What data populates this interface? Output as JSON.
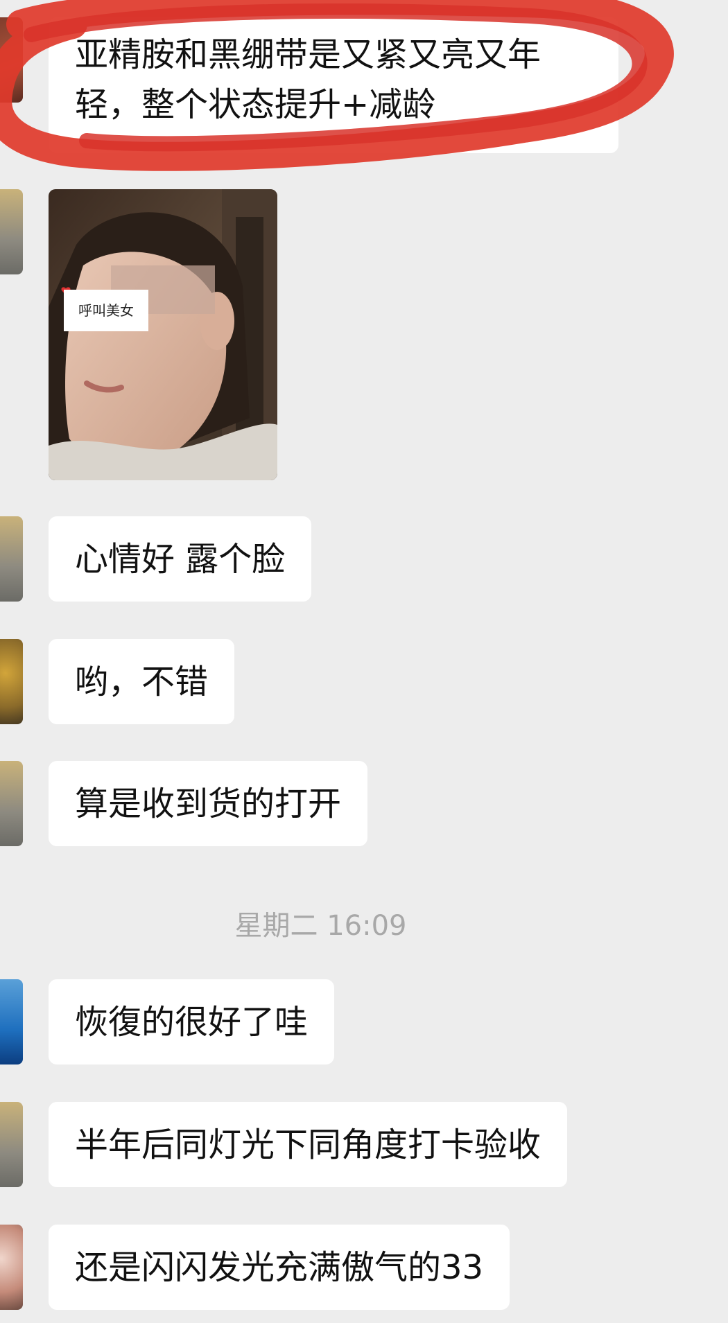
{
  "messages": [
    {
      "id": "m1",
      "text": "亚精胺和黑绷带是又紧又亮又年轻，整个状态提升+减龄"
    },
    {
      "id": "m2",
      "type": "image",
      "overlay_text": "呼叫美女"
    },
    {
      "id": "m3",
      "text": "心情好 露个脸"
    },
    {
      "id": "m4",
      "text": "哟，不错"
    },
    {
      "id": "m5",
      "text": "算是收到货的打开"
    },
    {
      "id": "ts1",
      "type": "timestamp",
      "text": "星期二 16:09"
    },
    {
      "id": "m6",
      "text": "恢復的很好了哇"
    },
    {
      "id": "m7",
      "text": "半年后同灯光下同角度打卡验收"
    },
    {
      "id": "m8",
      "text": "还是闪闪发光充满傲气的33"
    }
  ],
  "colors": {
    "background": "#ededed",
    "bubble": "#ffffff",
    "text": "#111111",
    "timestamp": "#a8a8a8",
    "highlight_stroke": "#e0392b"
  }
}
